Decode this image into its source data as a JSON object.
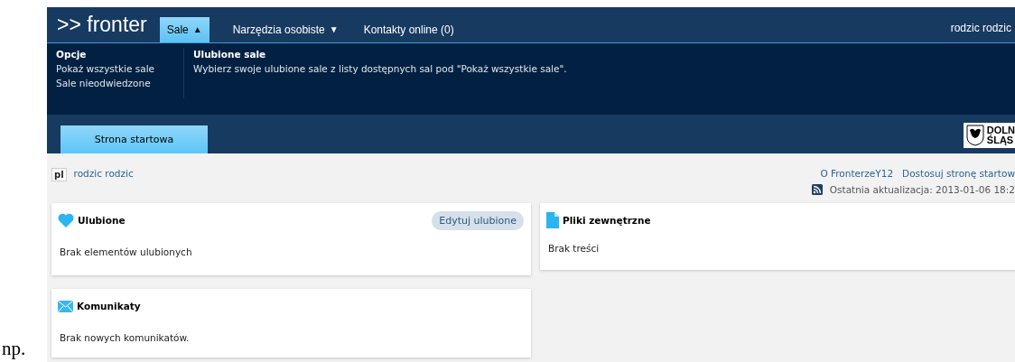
{
  "note": "np.",
  "logo": ">> fronter",
  "nav": [
    {
      "label": "Sale",
      "selected": true,
      "caret": "▲"
    },
    {
      "label": "Narzędzia osobiste",
      "selected": false,
      "caret": "▼"
    },
    {
      "label": "Kontakty online (0)",
      "selected": false
    }
  ],
  "user_menu": "rodzic rodzic",
  "submenu": {
    "options_title": "Opcje",
    "options": [
      "Pokaż wszystkie sale",
      "Sale nieodwiedzone"
    ],
    "info_title": "Ulubione sale",
    "info_text": "Wybierz swoje ulubione sale z listy dostępnych sal pod \"Pokaż wszystkie sale\"."
  },
  "page_tabs": [
    {
      "label": "Strona startowa",
      "selected": true
    }
  ],
  "region_logo": [
    "DOLN",
    "ŚLĄS"
  ],
  "language": "pl",
  "user_link": "rodzic rodzic",
  "top_links": [
    "O FronterzeY12",
    "Dostosuj stronę startow"
  ],
  "last_update": "Ostatnia aktualizacja: 2013-01-06 18:2",
  "columns": [
    {
      "cards": [
        {
          "kind": "favorites",
          "title": "Ulubione",
          "action": "Edytuj ulubione",
          "body": "Brak elementów ulubionych"
        },
        {
          "kind": "messages",
          "title": "Komunikaty",
          "body": "Brak nowych komunikatów."
        }
      ]
    },
    {
      "cards": [
        {
          "kind": "files",
          "title": "Pliki zewnętrzne",
          "body": "Brak treści"
        }
      ]
    }
  ]
}
